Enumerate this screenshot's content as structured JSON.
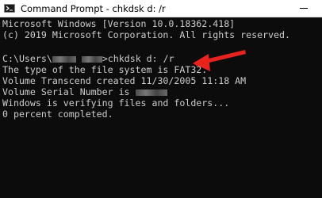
{
  "window": {
    "title": "Command Prompt - chkdsk  d: /r",
    "icon": "cmd-icon",
    "controls": [
      "minimize-icon"
    ]
  },
  "console": {
    "banner_line1": "Microsoft Windows [Version 10.0.18362.418]",
    "banner_line2": "(c) 2019 Microsoft Corporation. All rights reserved.",
    "prompt_prefix": "C:\\Users\\",
    "prompt_suffix": ">chkdsk d: /r",
    "output": [
      "The type of the file system is FAT32.",
      "Volume Transcend created 11/30/2005 11:18 AM",
      "Volume Serial Number is",
      "Windows is verifying files and folders...",
      "0 percent completed."
    ]
  },
  "annotation": {
    "arrow_color": "#e8231d",
    "arrow_target": "chkdsk-command"
  },
  "colors": {
    "console_background": "#0c0c0c",
    "console_text": "#cccccc",
    "titlebar_background": "#ffffff"
  }
}
